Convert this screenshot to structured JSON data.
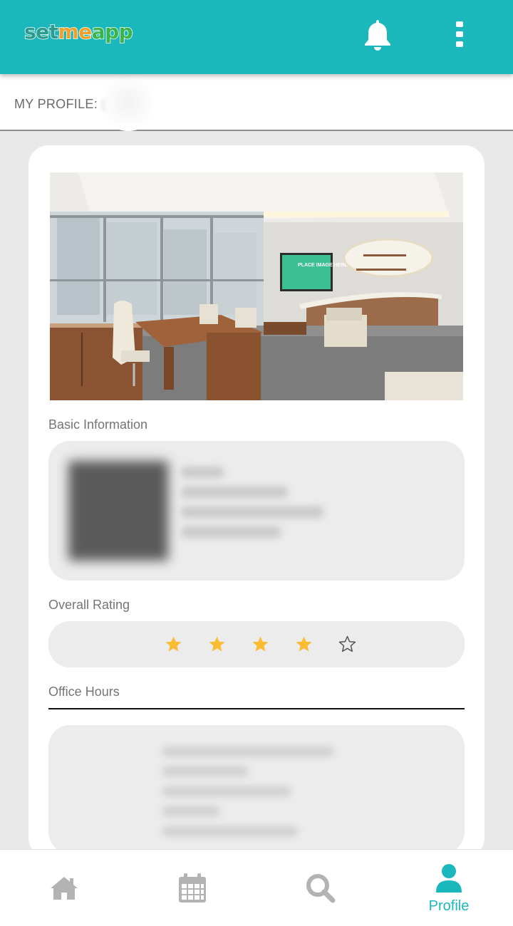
{
  "app": {
    "logo_text_parts": [
      "set",
      "me",
      "app"
    ],
    "brand_color": "#1ab8bd"
  },
  "topbar": {
    "notifications_icon": "bell-icon",
    "menu_icon": "more-vertical-icon"
  },
  "profile_strip": {
    "label": "MY PROFILE: ",
    "name_visible": "("
  },
  "card": {
    "image": {
      "placeholder_sign": "PLACE IMAGE HERE"
    },
    "basic_information": {
      "heading": "Basic Information"
    },
    "overall_rating": {
      "heading": "Overall Rating",
      "value": 4,
      "max": 5,
      "star_color": "#fbbb32"
    },
    "office_hours": {
      "heading": "Office Hours"
    }
  },
  "bottom_nav": {
    "items": [
      {
        "id": "home",
        "icon": "home-icon",
        "label": "",
        "active": false
      },
      {
        "id": "calendar",
        "icon": "calendar-icon",
        "label": "",
        "active": false
      },
      {
        "id": "search",
        "icon": "search-icon",
        "label": "",
        "active": false
      },
      {
        "id": "profile",
        "icon": "user-icon",
        "label": "Profile",
        "active": true
      }
    ],
    "inactive_color": "#b3b3b3",
    "active_color": "#1ab8bd"
  }
}
